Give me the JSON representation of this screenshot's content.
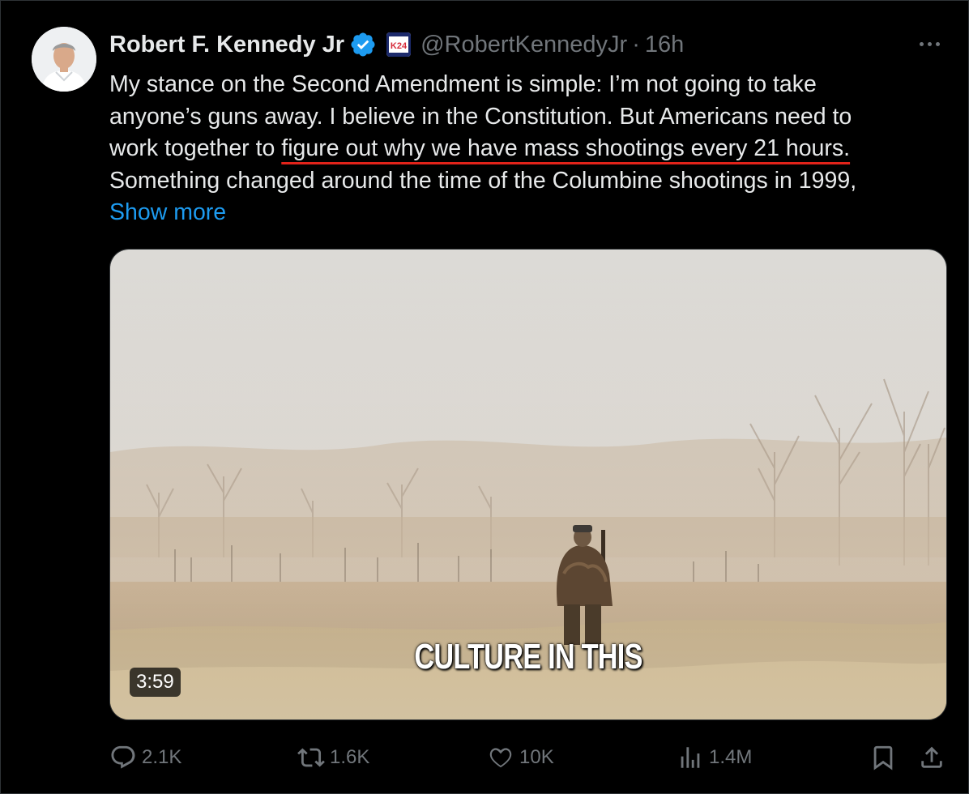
{
  "tweet": {
    "author_name": "Robert F. Kennedy Jr",
    "handle": "@RobertKennedyJr",
    "separator": "·",
    "time": "16h",
    "affiliation_badge": "K24",
    "lines": {
      "l1": "My stance on the Second Amendment is simple: I’m not going to take",
      "l2": "anyone’s guns away. I believe in the Constitution. But Americans need to",
      "l3_pre": "work together to ",
      "l3_underlined": "figure out why we have mass shootings every 21 hours.",
      "l4": "Something changed around the time of the Columbine shootings in 1999,"
    },
    "show_more": "Show more"
  },
  "media": {
    "caption": "CULTURE IN THIS",
    "duration": "3:59"
  },
  "actions": {
    "replies": "2.1K",
    "reposts": "1.6K",
    "likes": "10K",
    "views": "1.4M"
  },
  "icons": {
    "reply": "speech-bubble-icon",
    "repost": "repost-arrows-icon",
    "like": "heart-icon",
    "views": "bar-chart-icon",
    "bookmark": "bookmark-icon",
    "share": "share-upload-icon",
    "verified": "verified-badge-icon",
    "more": "more-dots-icon"
  },
  "colors": {
    "background": "#000000",
    "text": "#e7e9ea",
    "secondary": "#71767b",
    "link": "#1d9bf0",
    "verified": "#1d9bf0",
    "underline": "#e2231a"
  }
}
